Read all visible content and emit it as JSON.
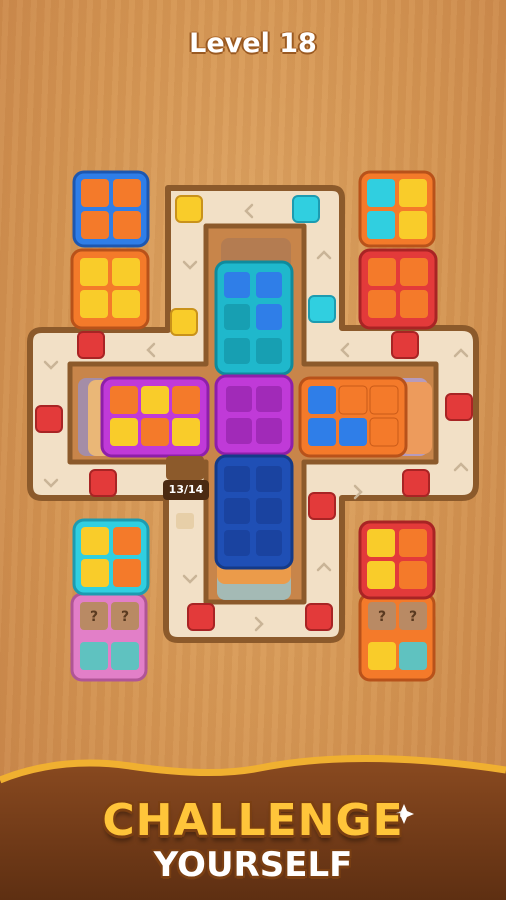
{
  "level": {
    "label": "Level 18"
  },
  "board": {
    "progress_counter": "13/14"
  },
  "footer": {
    "line1": "CHALLENGE",
    "line2": "YOURSELF"
  },
  "stacks": {
    "mystery_marker": "?"
  },
  "colors": {
    "wood_bg": "#d49553",
    "track": "#f2e0c6",
    "track_border": "#8c5a2b",
    "orange": "#f47a2a",
    "yellow": "#f9cc2a",
    "blue": "#2f7ee8",
    "dark_blue": "#1f4fb5",
    "cyan": "#30cfe0",
    "magenta": "#c03ad8",
    "red": "#e33a3a",
    "pink": "#e27fc8",
    "teal": "#5fc2c0"
  },
  "icons": [
    "sparkle-icon",
    "arrow-chevron-icon"
  ]
}
